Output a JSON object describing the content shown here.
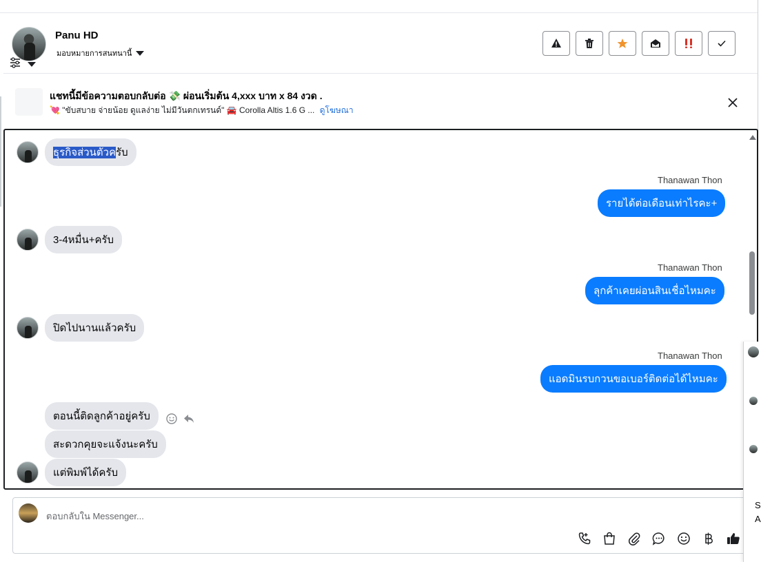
{
  "header": {
    "user_name": "Panu HD",
    "assign_label": "มอบหมายการสนทนานี้",
    "actions": [
      {
        "icon": "warning-icon",
        "name": "spam-button"
      },
      {
        "icon": "trash-icon",
        "name": "delete-button"
      },
      {
        "icon": "star-icon",
        "name": "star-button"
      },
      {
        "icon": "mark-unread-icon",
        "name": "mark-unread-button"
      },
      {
        "icon": "priority-icon",
        "name": "priority-button"
      },
      {
        "icon": "check-icon",
        "name": "done-button"
      }
    ],
    "colors": {
      "star": "#f0932b",
      "priority": "#d93025"
    }
  },
  "ad": {
    "title": "แชทนี้มีข้อความตอบกลับต่อ 💸 ผ่อนเริ่มต้น 4,xxx บาท x 84 งวด .",
    "subtitle": "💘 \"ขับสบาย จ่ายน้อย ดูแลง่าย ไม่มีวันตกเทรนด์\" 🚘 Corolla Altis 1.6 G ...",
    "link": "ดูโฆษณา"
  },
  "messages": {
    "m1_highlight": "ธุรกิจส่วนตัวค",
    "m1_rest": "รับ",
    "sender": "Thanawan Thon",
    "m2": "รายได้ต่อเดือนเท่าไรคะ+",
    "m3": "3-4หมื่น+ครับ",
    "m4": "ลุกค้าเคยผ่อนสินเชื่อไหมคะ",
    "m5": "ปิดไปนานแล้วครับ",
    "m6": "แอดมินรบกวนขอเบอร์ติดต่อได้ไหมคะ",
    "m7": "ตอนนี้ติดลูกค้าอยู่ครับ",
    "m8": "สะดวกคุยจะแจ้งนะครับ",
    "m9": "แต่พิมพ์ได้ครับ"
  },
  "composer": {
    "placeholder": "ตอบกลับใน Messenger...",
    "tools": [
      "call-icon",
      "shop-icon",
      "attach-icon",
      "saved-reply-icon",
      "emoji-icon",
      "baht-icon",
      "like-icon"
    ]
  },
  "right_panel": {
    "text_1": "S",
    "text_2": "A"
  },
  "accent": "#0a7cff"
}
